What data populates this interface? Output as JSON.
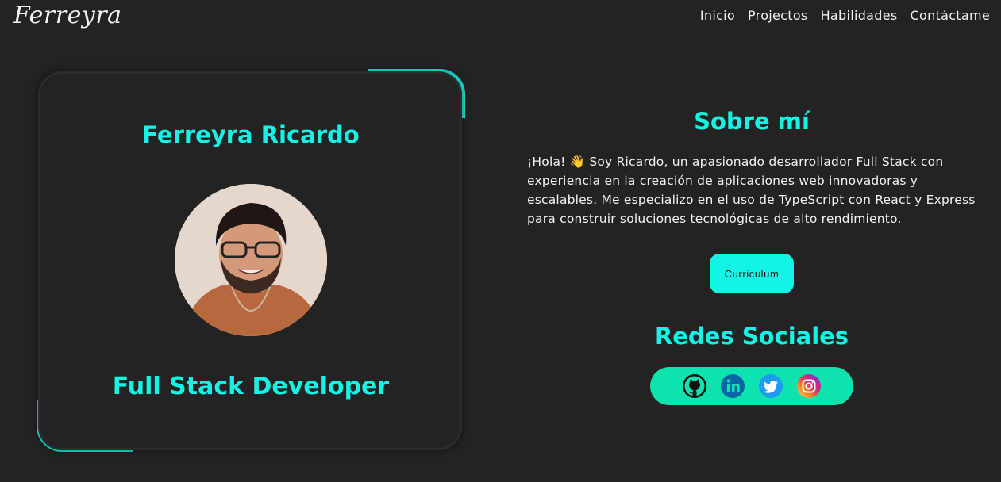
{
  "header": {
    "logo": "Ferreyra",
    "nav": [
      {
        "label": "Inicio"
      },
      {
        "label": "Projectos"
      },
      {
        "label": "Habilidades"
      },
      {
        "label": "Contáctame"
      }
    ]
  },
  "profile": {
    "name": "Ferreyra Ricardo",
    "role": "Full Stack Developer"
  },
  "about": {
    "title": "Sobre mí",
    "text": "¡Hola! 👋 Soy Ricardo, un apasionado desarrollador Full Stack con experiencia en la creación de aplicaciones web innovadoras y escalables. Me especializo en el uso de TypeScript con React y Express para construir soluciones tecnológicas de alto rendimiento.",
    "cv_button": "Curriculum"
  },
  "social": {
    "title": "Redes Sociales",
    "icons": [
      "github-icon",
      "linkedin-icon",
      "twitter-icon",
      "instagram-icon"
    ]
  },
  "colors": {
    "accent": "#14f4e4",
    "social_bar": "#0ee2ae",
    "background": "#232323"
  }
}
